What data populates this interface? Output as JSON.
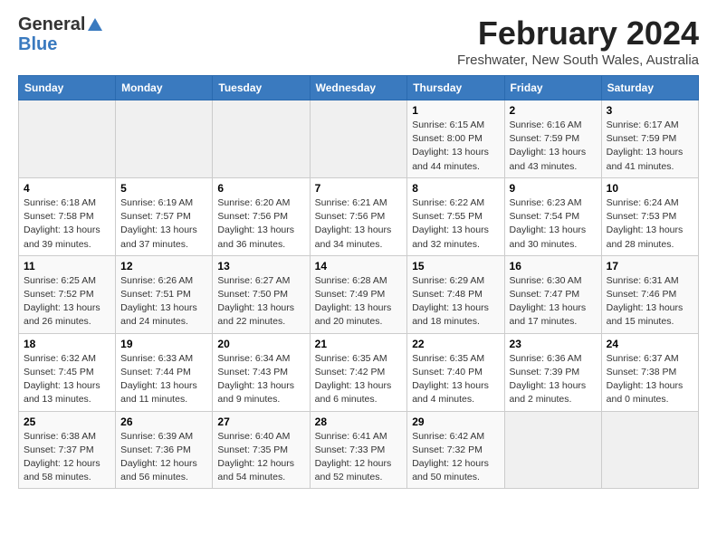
{
  "logo": {
    "general": "General",
    "blue": "Blue"
  },
  "title": "February 2024",
  "subtitle": "Freshwater, New South Wales, Australia",
  "headers": [
    "Sunday",
    "Monday",
    "Tuesday",
    "Wednesday",
    "Thursday",
    "Friday",
    "Saturday"
  ],
  "weeks": [
    [
      {
        "day": "",
        "info": ""
      },
      {
        "day": "",
        "info": ""
      },
      {
        "day": "",
        "info": ""
      },
      {
        "day": "",
        "info": ""
      },
      {
        "day": "1",
        "info": "Sunrise: 6:15 AM\nSunset: 8:00 PM\nDaylight: 13 hours\nand 44 minutes."
      },
      {
        "day": "2",
        "info": "Sunrise: 6:16 AM\nSunset: 7:59 PM\nDaylight: 13 hours\nand 43 minutes."
      },
      {
        "day": "3",
        "info": "Sunrise: 6:17 AM\nSunset: 7:59 PM\nDaylight: 13 hours\nand 41 minutes."
      }
    ],
    [
      {
        "day": "4",
        "info": "Sunrise: 6:18 AM\nSunset: 7:58 PM\nDaylight: 13 hours\nand 39 minutes."
      },
      {
        "day": "5",
        "info": "Sunrise: 6:19 AM\nSunset: 7:57 PM\nDaylight: 13 hours\nand 37 minutes."
      },
      {
        "day": "6",
        "info": "Sunrise: 6:20 AM\nSunset: 7:56 PM\nDaylight: 13 hours\nand 36 minutes."
      },
      {
        "day": "7",
        "info": "Sunrise: 6:21 AM\nSunset: 7:56 PM\nDaylight: 13 hours\nand 34 minutes."
      },
      {
        "day": "8",
        "info": "Sunrise: 6:22 AM\nSunset: 7:55 PM\nDaylight: 13 hours\nand 32 minutes."
      },
      {
        "day": "9",
        "info": "Sunrise: 6:23 AM\nSunset: 7:54 PM\nDaylight: 13 hours\nand 30 minutes."
      },
      {
        "day": "10",
        "info": "Sunrise: 6:24 AM\nSunset: 7:53 PM\nDaylight: 13 hours\nand 28 minutes."
      }
    ],
    [
      {
        "day": "11",
        "info": "Sunrise: 6:25 AM\nSunset: 7:52 PM\nDaylight: 13 hours\nand 26 minutes."
      },
      {
        "day": "12",
        "info": "Sunrise: 6:26 AM\nSunset: 7:51 PM\nDaylight: 13 hours\nand 24 minutes."
      },
      {
        "day": "13",
        "info": "Sunrise: 6:27 AM\nSunset: 7:50 PM\nDaylight: 13 hours\nand 22 minutes."
      },
      {
        "day": "14",
        "info": "Sunrise: 6:28 AM\nSunset: 7:49 PM\nDaylight: 13 hours\nand 20 minutes."
      },
      {
        "day": "15",
        "info": "Sunrise: 6:29 AM\nSunset: 7:48 PM\nDaylight: 13 hours\nand 18 minutes."
      },
      {
        "day": "16",
        "info": "Sunrise: 6:30 AM\nSunset: 7:47 PM\nDaylight: 13 hours\nand 17 minutes."
      },
      {
        "day": "17",
        "info": "Sunrise: 6:31 AM\nSunset: 7:46 PM\nDaylight: 13 hours\nand 15 minutes."
      }
    ],
    [
      {
        "day": "18",
        "info": "Sunrise: 6:32 AM\nSunset: 7:45 PM\nDaylight: 13 hours\nand 13 minutes."
      },
      {
        "day": "19",
        "info": "Sunrise: 6:33 AM\nSunset: 7:44 PM\nDaylight: 13 hours\nand 11 minutes."
      },
      {
        "day": "20",
        "info": "Sunrise: 6:34 AM\nSunset: 7:43 PM\nDaylight: 13 hours\nand 9 minutes."
      },
      {
        "day": "21",
        "info": "Sunrise: 6:35 AM\nSunset: 7:42 PM\nDaylight: 13 hours\nand 6 minutes."
      },
      {
        "day": "22",
        "info": "Sunrise: 6:35 AM\nSunset: 7:40 PM\nDaylight: 13 hours\nand 4 minutes."
      },
      {
        "day": "23",
        "info": "Sunrise: 6:36 AM\nSunset: 7:39 PM\nDaylight: 13 hours\nand 2 minutes."
      },
      {
        "day": "24",
        "info": "Sunrise: 6:37 AM\nSunset: 7:38 PM\nDaylight: 13 hours\nand 0 minutes."
      }
    ],
    [
      {
        "day": "25",
        "info": "Sunrise: 6:38 AM\nSunset: 7:37 PM\nDaylight: 12 hours\nand 58 minutes."
      },
      {
        "day": "26",
        "info": "Sunrise: 6:39 AM\nSunset: 7:36 PM\nDaylight: 12 hours\nand 56 minutes."
      },
      {
        "day": "27",
        "info": "Sunrise: 6:40 AM\nSunset: 7:35 PM\nDaylight: 12 hours\nand 54 minutes."
      },
      {
        "day": "28",
        "info": "Sunrise: 6:41 AM\nSunset: 7:33 PM\nDaylight: 12 hours\nand 52 minutes."
      },
      {
        "day": "29",
        "info": "Sunrise: 6:42 AM\nSunset: 7:32 PM\nDaylight: 12 hours\nand 50 minutes."
      },
      {
        "day": "",
        "info": ""
      },
      {
        "day": "",
        "info": ""
      }
    ]
  ]
}
